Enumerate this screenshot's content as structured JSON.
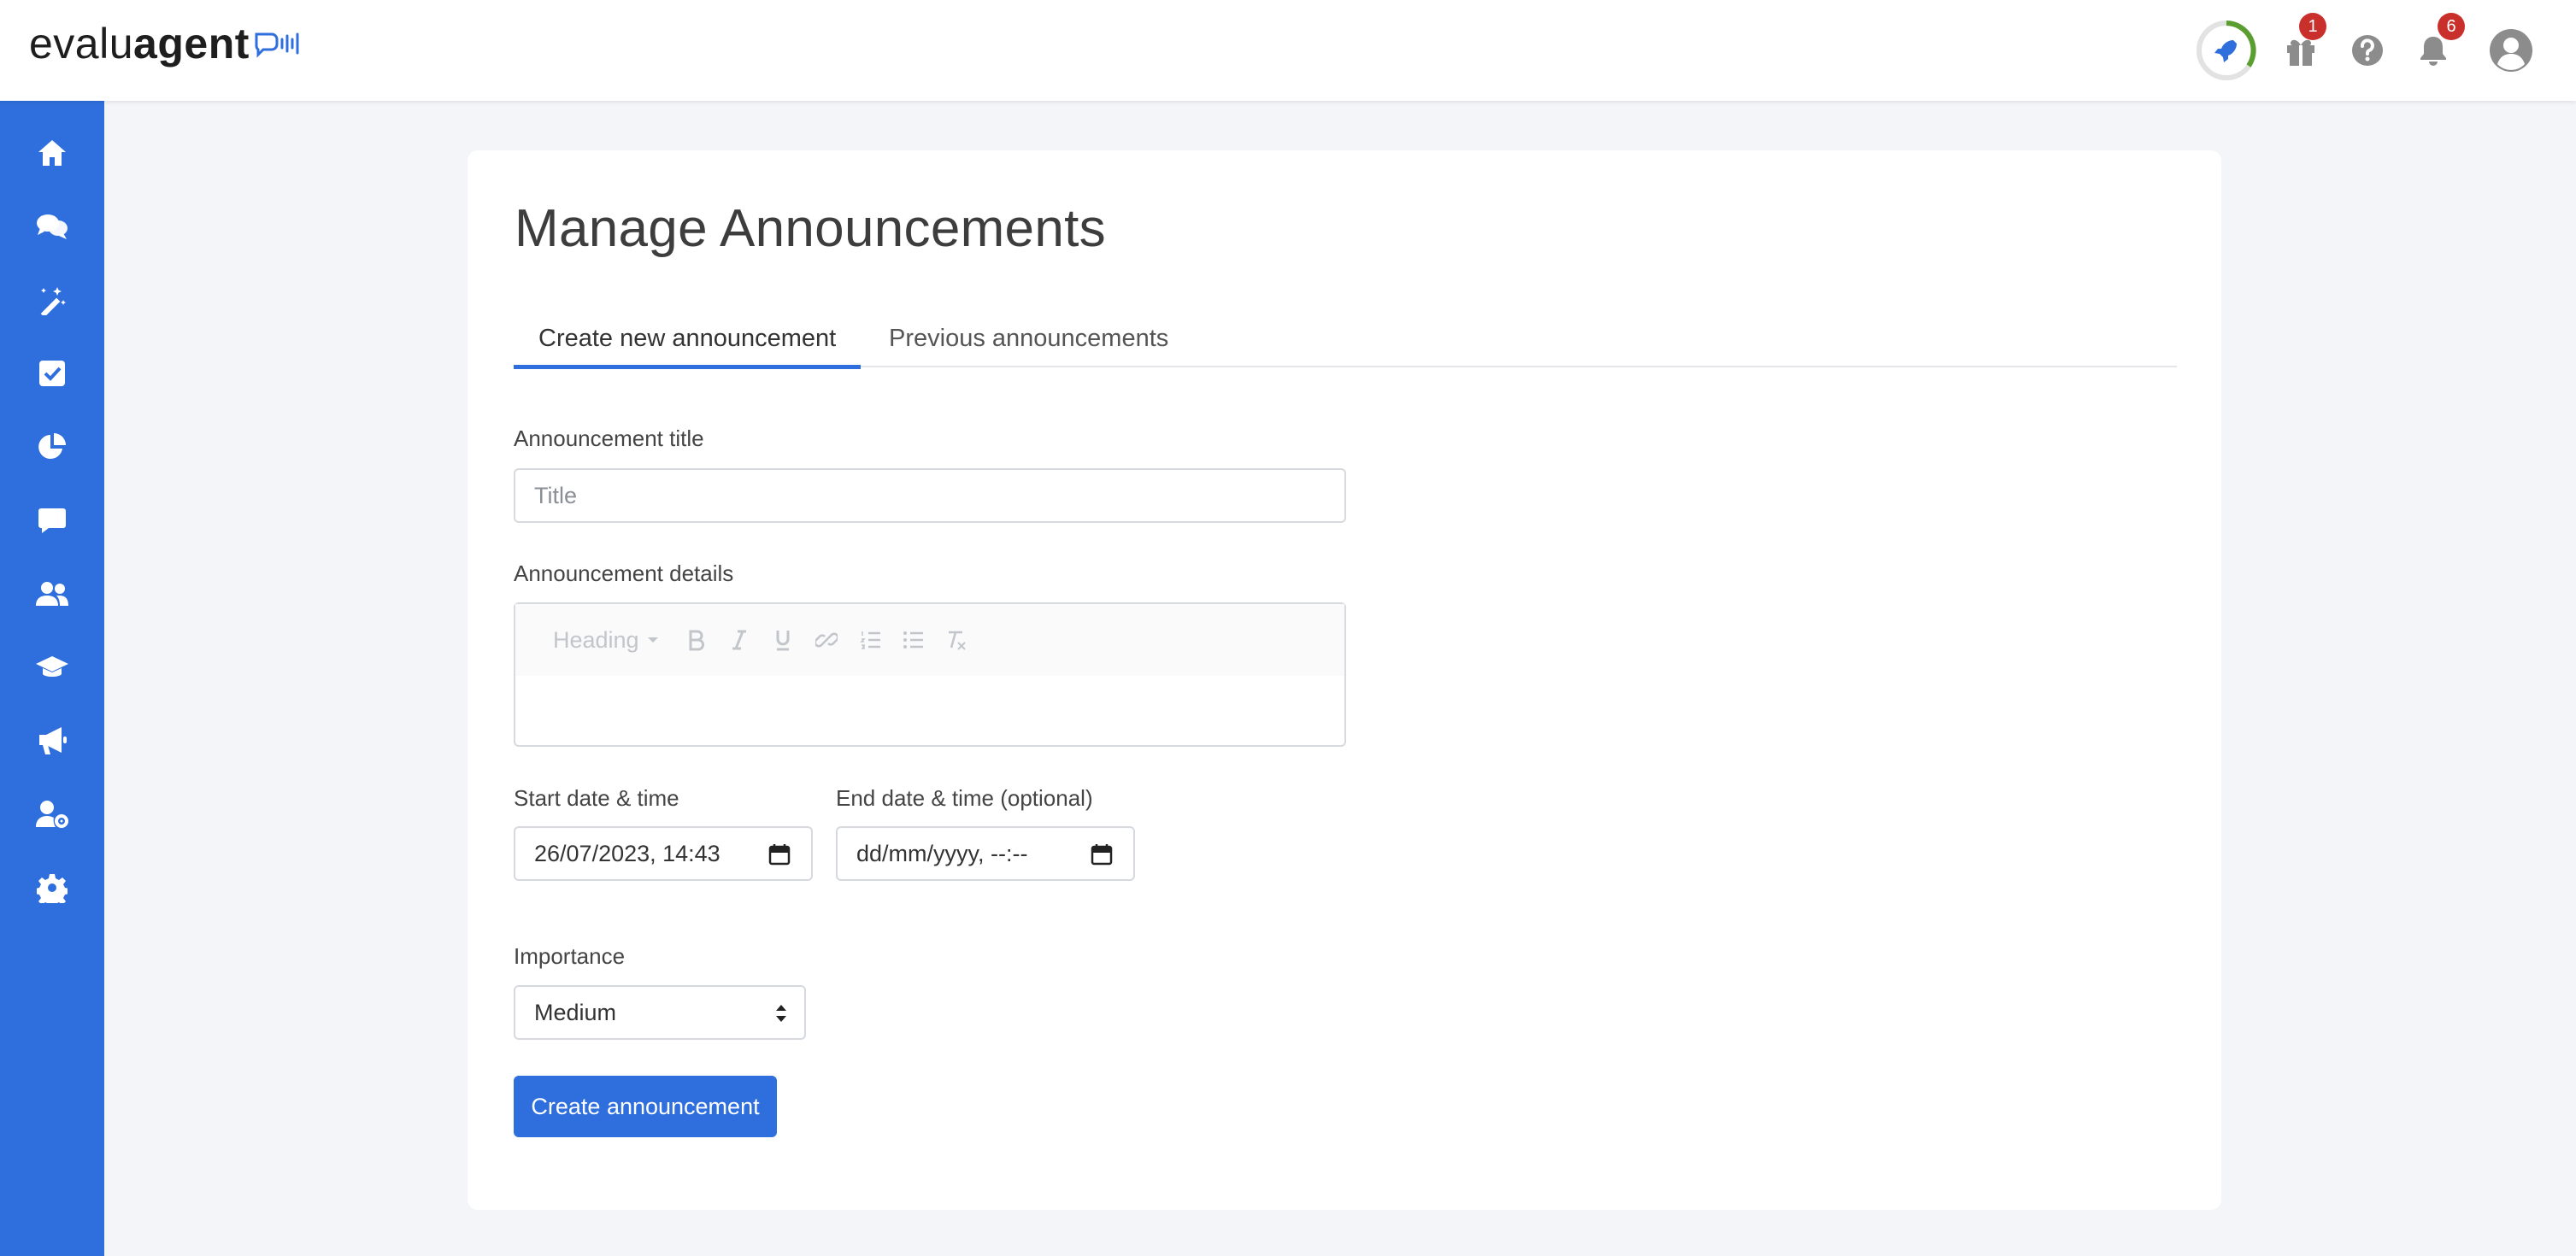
{
  "app": {
    "logo_prefix": "evalu",
    "logo_suffix": "agent",
    "accent_color": "#2f6fdd"
  },
  "header": {
    "rocket_progress_icon": "rocket-icon",
    "gift_badge": "1",
    "notification_badge": "6"
  },
  "sidebar": {
    "items": [
      {
        "icon": "home-icon"
      },
      {
        "icon": "conversations-icon"
      },
      {
        "icon": "magic-wand-icon"
      },
      {
        "icon": "checkbox-icon"
      },
      {
        "icon": "pie-chart-icon"
      },
      {
        "icon": "comment-icon"
      },
      {
        "icon": "users-icon"
      },
      {
        "icon": "graduation-cap-icon"
      },
      {
        "icon": "megaphone-icon"
      },
      {
        "icon": "user-settings-icon"
      },
      {
        "icon": "gear-icon"
      }
    ]
  },
  "main": {
    "title": "Manage Announcements",
    "tabs": [
      {
        "label": "Create new announcement",
        "active": true
      },
      {
        "label": "Previous announcements",
        "active": false
      }
    ],
    "form": {
      "title_label": "Announcement title",
      "title_placeholder": "Title",
      "details_label": "Announcement details",
      "editor_heading": "Heading",
      "start_label": "Start date & time",
      "start_value": "26/07/2023, 14:43",
      "end_label": "End date & time (optional)",
      "end_value": "dd/mm/yyyy, --:--",
      "importance_label": "Importance",
      "importance_value": "Medium",
      "submit_label": "Create announcement"
    }
  }
}
